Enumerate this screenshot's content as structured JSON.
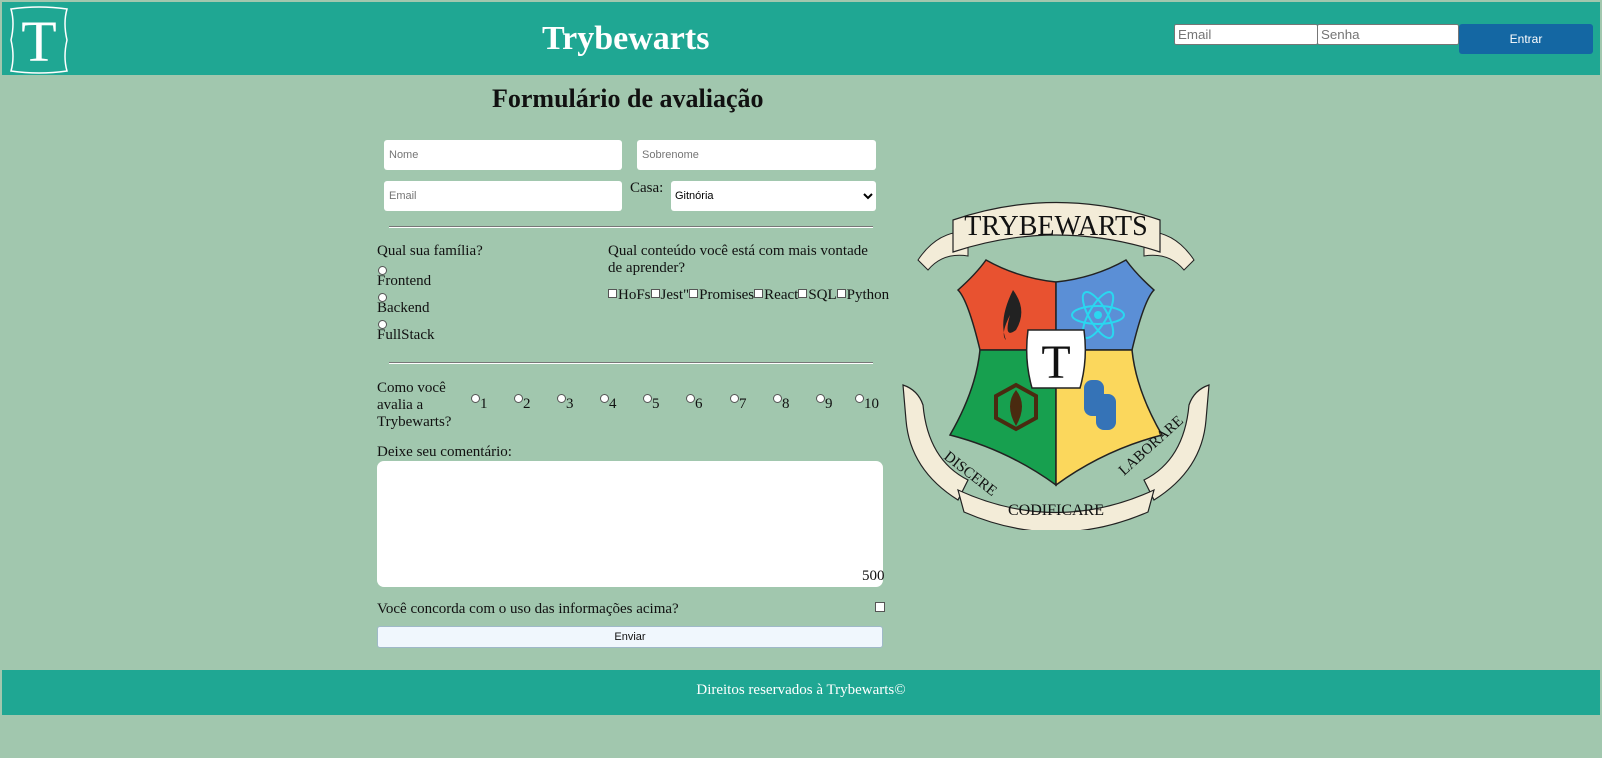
{
  "header": {
    "logo_letter": "T",
    "title": "Trybewarts",
    "login": {
      "email_placeholder": "Email",
      "password_placeholder": "Senha",
      "submit_label": "Entrar"
    }
  },
  "form": {
    "title": "Formulário de avaliação",
    "name_placeholder": "Nome",
    "lastname_placeholder": "Sobrenome",
    "email_placeholder": "Email",
    "house_label": "Casa:",
    "house_selected": "Gitnória",
    "family_question": "Qual sua família?",
    "family_options": [
      "Frontend",
      "Backend",
      "FullStack"
    ],
    "content_question": "Qual conteúdo você está com mais vontade de aprender?",
    "content_options": [
      "HoFs",
      "Jest\"",
      "Promises",
      "React",
      "SQL",
      "Python"
    ],
    "rating_question": "Como você avalia a Trybewarts?",
    "rating_options": [
      "1",
      "2",
      "3",
      "4",
      "5",
      "6",
      "7",
      "8",
      "9",
      "10"
    ],
    "comment_label": "Deixe seu comentário:",
    "counter": "500",
    "agree_label": "Você concorda com o uso das informações acima?",
    "submit_label": "Enviar"
  },
  "crest": {
    "banner_top": "TRYBEWARTS",
    "banner_left": "DISCERE",
    "banner_bottom": "CODIFICARE",
    "banner_right": "LABORARE",
    "center_letter": "T"
  },
  "footer": {
    "text": "Direitos reservados à Trybewarts©"
  },
  "colors": {
    "background": "#a1c7ae",
    "header": "#1fa793",
    "login_button": "#1467a3"
  }
}
